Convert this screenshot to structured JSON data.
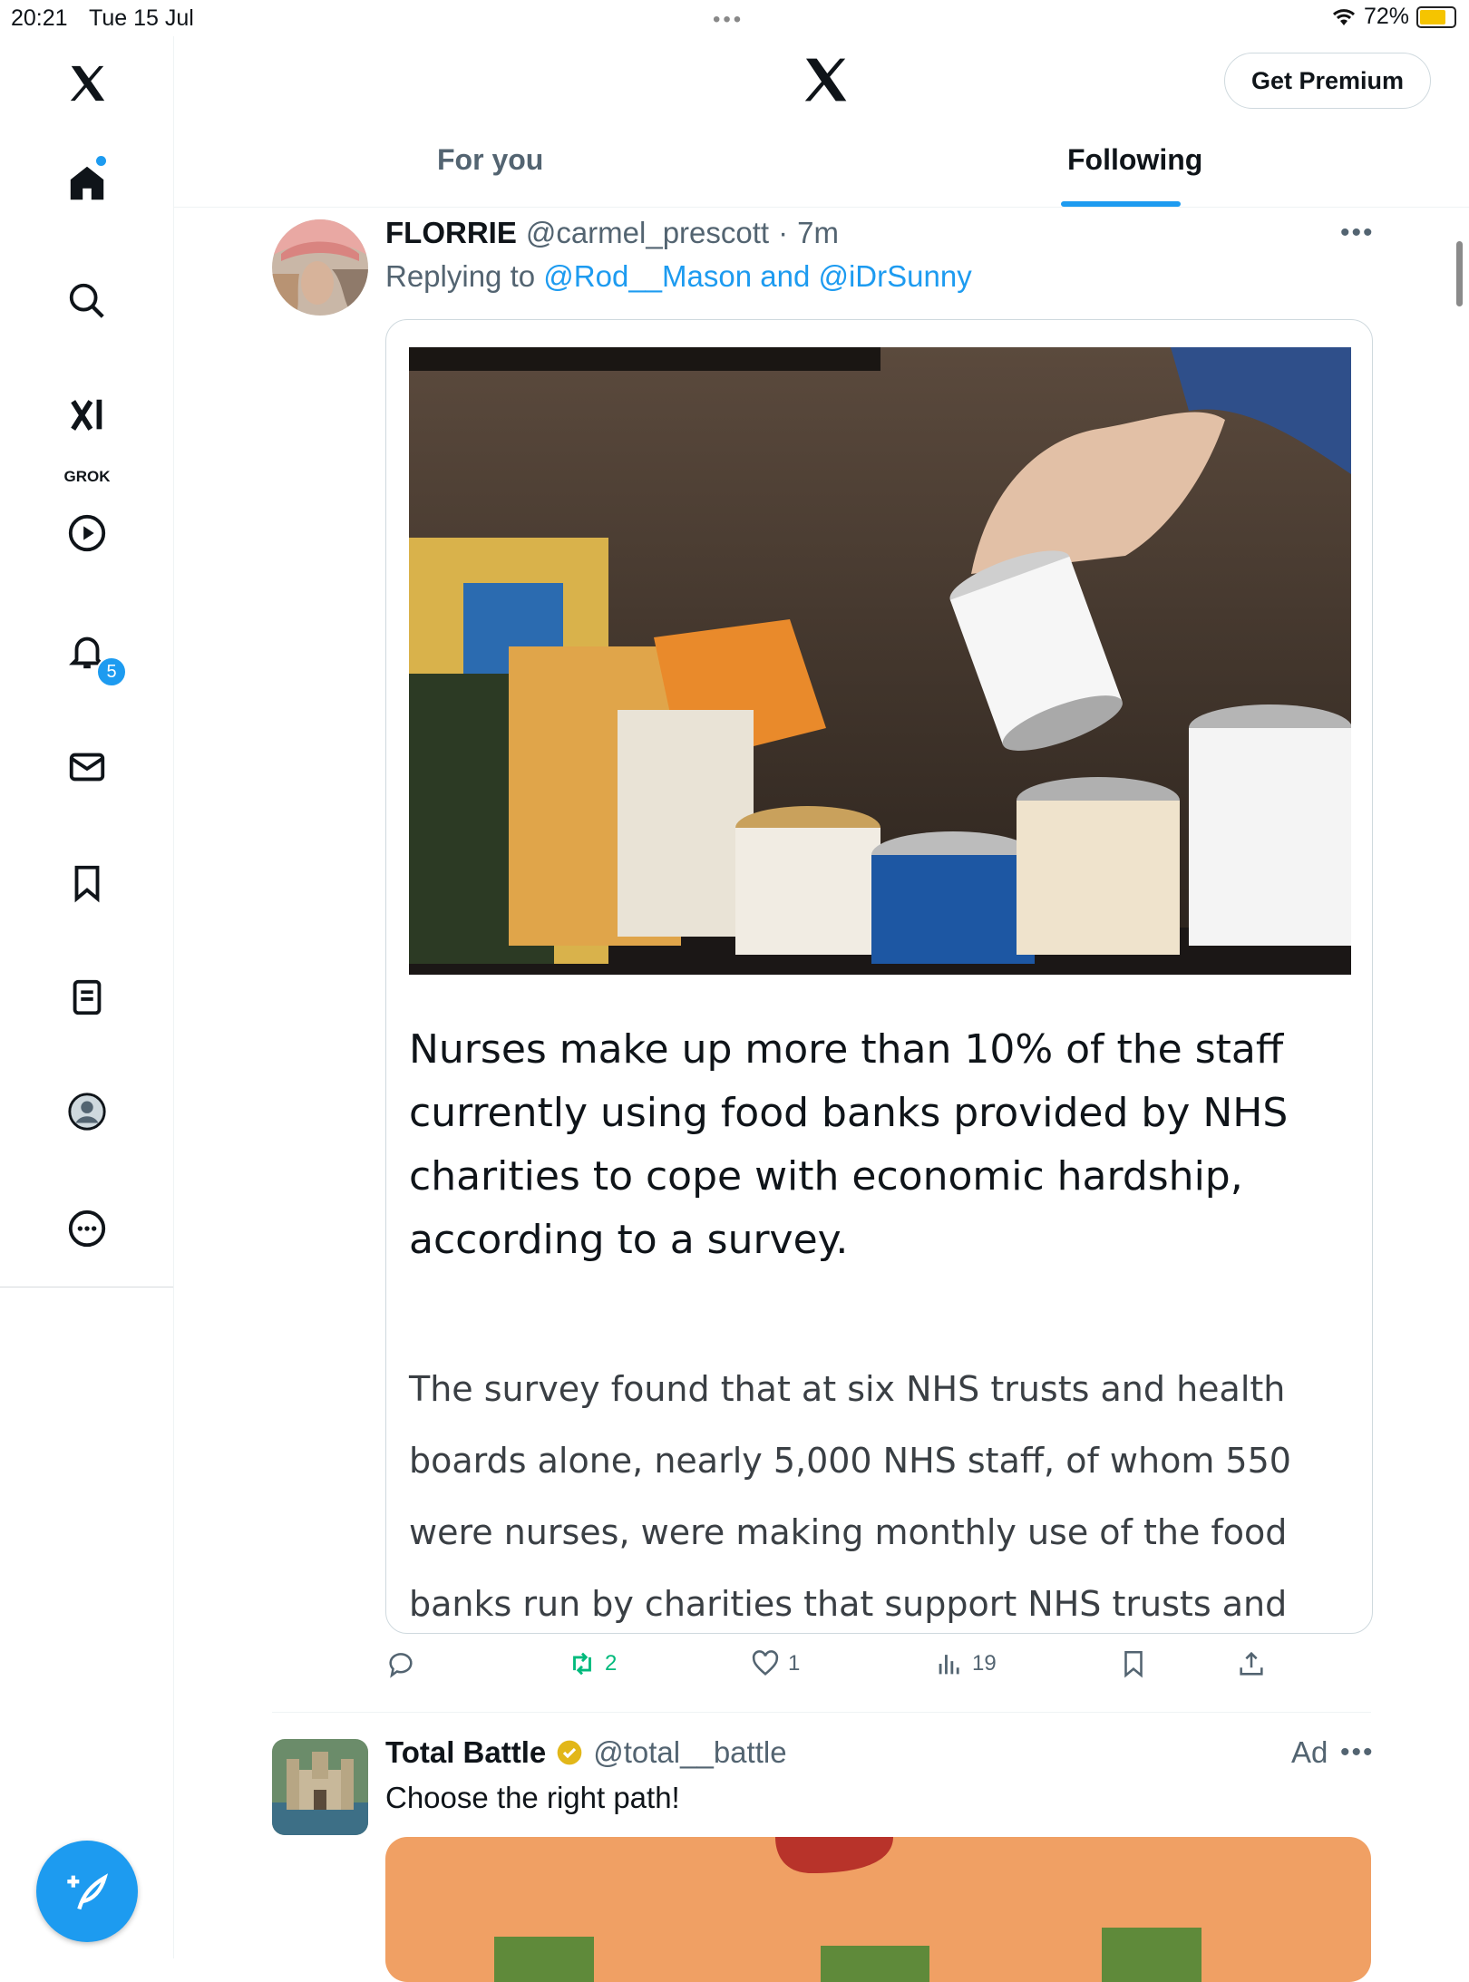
{
  "status_bar": {
    "time": "20:21",
    "date": "Tue 15 Jul",
    "battery": "72%"
  },
  "sidebar": {
    "items": [
      {
        "icon": "x-logo-icon"
      },
      {
        "icon": "home-icon"
      },
      {
        "icon": "search-icon"
      },
      {
        "icon": "grok-icon",
        "label": "GROK"
      },
      {
        "icon": "video-play-icon"
      },
      {
        "icon": "bell-icon",
        "badge": "5"
      },
      {
        "icon": "mail-icon"
      },
      {
        "icon": "bookmark-icon"
      },
      {
        "icon": "list-icon"
      },
      {
        "icon": "profile-icon"
      },
      {
        "icon": "more-icon"
      }
    ],
    "compose_icon": "compose-feather-icon"
  },
  "header": {
    "premium_label": "Get Premium",
    "tabs": [
      {
        "label": "For you",
        "active": false
      },
      {
        "label": "Following",
        "active": true
      }
    ]
  },
  "tweets": [
    {
      "name": "FLORRIE",
      "handle": "@carmel_prescott",
      "time": "7m",
      "reply_prefix": "Replying to",
      "reply_to": "@Rod__Mason and @iDrSunny",
      "card_headline": "Nurses make up more than 10% of the staff currently using food banks provided by NHS charities to cope with economic hardship, according to a survey.",
      "card_body": "The survey found that at six NHS trusts and health boards alone, nearly 5,000 NHS staff, of whom 550 were nurses, were making monthly use of the food banks run by charities that support NHS trusts and health boards.",
      "actions": {
        "reply": "",
        "retweet": "2",
        "like": "1",
        "views": "19"
      }
    },
    {
      "name": "Total Battle",
      "handle": "@total__battle",
      "ad_label": "Ad",
      "text": "Choose the right path!"
    }
  ],
  "colors": {
    "accent": "#1d9bf0",
    "retweet_active": "#00ba7c",
    "secondary_text": "#536471",
    "verified_gold": "#e2b719"
  }
}
